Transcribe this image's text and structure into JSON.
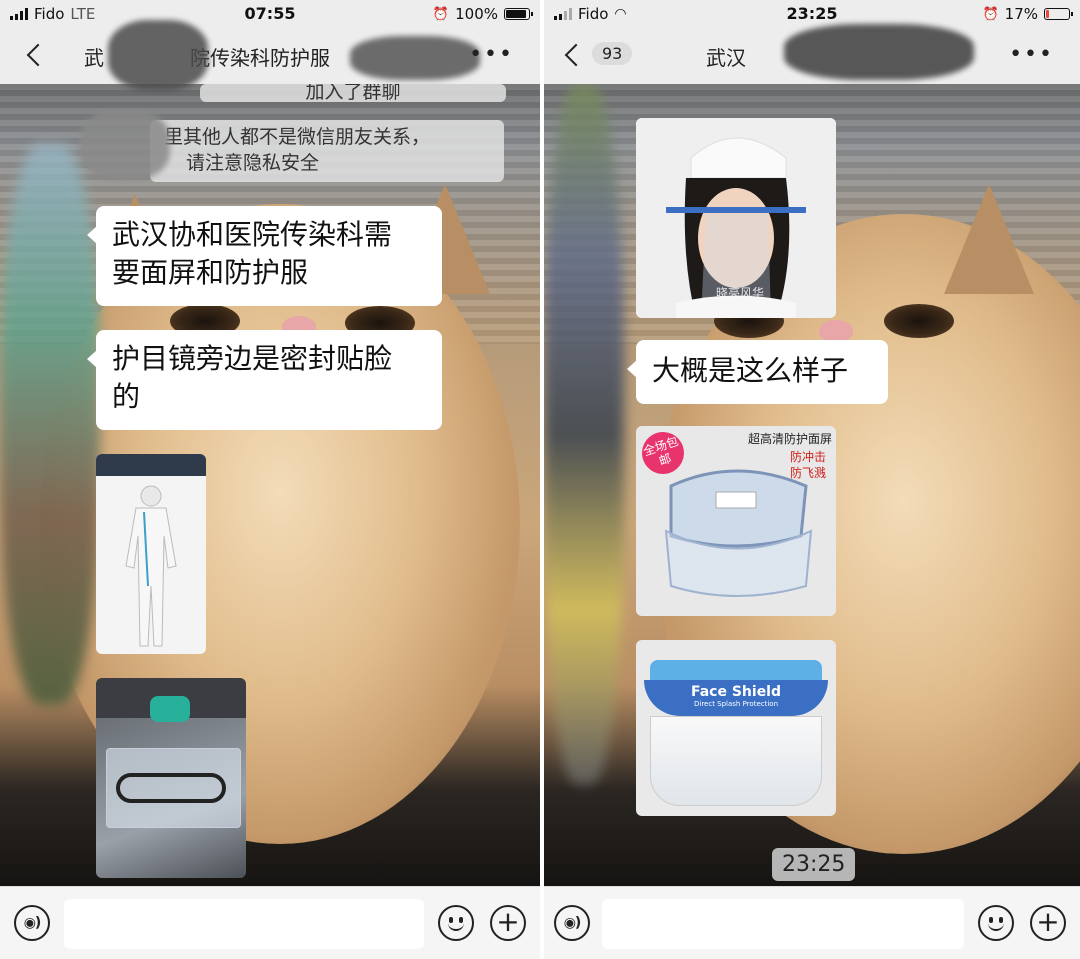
{
  "left_screen": {
    "status": {
      "carrier": "Fido",
      "network": "LTE",
      "time": "07:55",
      "battery": "100%",
      "battery_level": 1.0
    },
    "nav": {
      "title": "武汉协和医院传染科防护服",
      "title_visible": "武",
      "title_visible_2": "院传染科防护服"
    },
    "notices": [
      {
        "text": "加入了群聊"
      },
      {
        "line1": "里其他人都不是微信朋友关系，",
        "line2": "请注意隐私安全"
      }
    ],
    "messages": [
      {
        "type": "text",
        "line1": "武汉协和医院传染科需",
        "line2": "要面屏和防护服"
      },
      {
        "type": "text",
        "line1": "护目镜旁边是密封贴脸",
        "line2": "的"
      },
      {
        "type": "image",
        "description_icon": "protective-suit-photo"
      },
      {
        "type": "image",
        "description_icon": "goggles-package-photo"
      }
    ]
  },
  "right_screen": {
    "status": {
      "carrier": "Fido",
      "time": "23:25",
      "battery": "17%",
      "battery_level": 0.17
    },
    "nav": {
      "unread_count": "93",
      "title_visible": "武汉"
    },
    "messages": [
      {
        "type": "image",
        "description_icon": "nurse-face-shield-photo",
        "watermark": "晓亮风华"
      },
      {
        "type": "text",
        "line1": "大概是这么样子"
      },
      {
        "type": "image",
        "description_icon": "goggles-shield-photo",
        "promo_badge": "全场包邮",
        "headline": "超高清防护面屏",
        "sub1": "防冲击",
        "sub2": "防飞溅"
      },
      {
        "type": "image",
        "description_icon": "face-shield-photo",
        "brand": "Face Shield",
        "brand_sub": "Direct Splash Protection"
      }
    ],
    "time_chip": "23:25"
  },
  "colors": {
    "bubble": "#ffffff",
    "bar": "#ededed",
    "input_bg": "#f5f5f5",
    "badge_red": "#e8336d",
    "shield_blue": "#3a6fc4"
  }
}
